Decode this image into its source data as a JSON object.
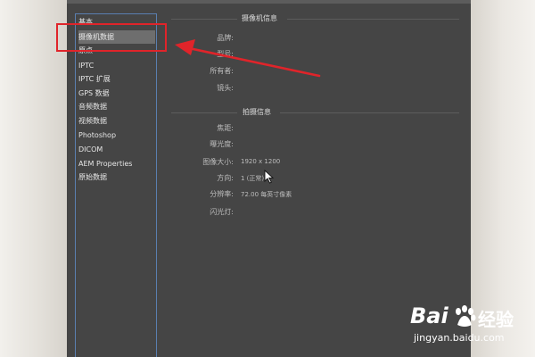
{
  "sidebar": {
    "items": [
      {
        "label": "基本"
      },
      {
        "label": "摄像机数据"
      },
      {
        "label": "原点"
      },
      {
        "label": "IPTC"
      },
      {
        "label": "IPTC 扩展"
      },
      {
        "label": "GPS 数据"
      },
      {
        "label": "音频数据"
      },
      {
        "label": "视频数据"
      },
      {
        "label": "Photoshop"
      },
      {
        "label": "DICOM"
      },
      {
        "label": "AEM Properties"
      },
      {
        "label": "原始数据"
      }
    ],
    "selected": "摄像机数据"
  },
  "camera_section": {
    "title": "摄像机信息",
    "fields": [
      {
        "label": "品牌:",
        "value": ""
      },
      {
        "label": "型号:",
        "value": ""
      },
      {
        "label": "所有者:",
        "value": ""
      },
      {
        "label": "镜头:",
        "value": ""
      }
    ]
  },
  "shoot_section": {
    "title": "拍摄信息",
    "fields": [
      {
        "label": "焦距:",
        "value": ""
      },
      {
        "label": "曝光度:",
        "value": ""
      },
      {
        "label": "图像大小:",
        "value": "1920 x 1200"
      },
      {
        "label": "方向:",
        "value": "1 (正常)"
      },
      {
        "label": "分辨率:",
        "value": "72.00 每英寸像素"
      },
      {
        "label": "闪光灯:",
        "value": ""
      }
    ]
  },
  "watermark": {
    "brand": "Bai",
    "suffix": "经验",
    "url": "jingyan.baidu.com"
  },
  "colors": {
    "dialog_bg": "#454545",
    "annotation_red": "#e0242a",
    "sidebar_border": "#5a7fb0"
  }
}
